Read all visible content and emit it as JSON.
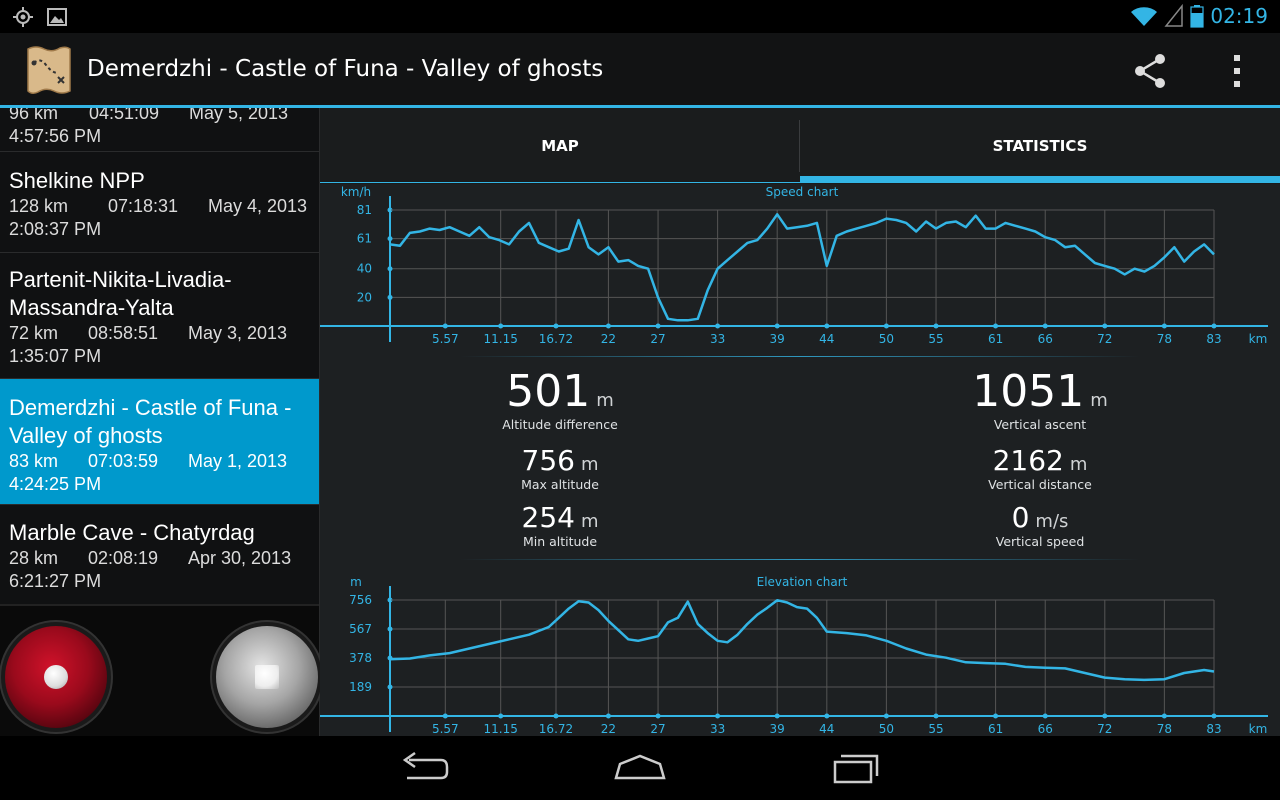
{
  "status_bar": {
    "time": "02:19",
    "icons": [
      "location-icon",
      "image-icon",
      "wifi-icon",
      "signal-icon",
      "battery-icon"
    ]
  },
  "action_bar": {
    "title": "Demerdzhi - Castle of Funa - Valley of ghosts",
    "actions": [
      "share-icon",
      "overflow-menu-icon"
    ]
  },
  "track_list": [
    {
      "name": "",
      "distance": "96 km",
      "duration": "04:51:09",
      "date": "May 5, 2013",
      "start_time": "4:57:56 PM",
      "selected": false
    },
    {
      "name": "Shelkine NPP",
      "distance": "128 km",
      "duration": "07:18:31",
      "date": "May 4, 2013",
      "start_time": "2:08:37 PM",
      "selected": false
    },
    {
      "name": "Partenit-Nikita-Livadia-Massandra-Yalta",
      "name_line1": "Partenit-Nikita-Livadia-",
      "name_line2": "Massandra-Yalta",
      "distance": "72 km",
      "duration": "08:58:51",
      "date": "May 3, 2013",
      "start_time": "1:35:07 PM",
      "selected": false
    },
    {
      "name": "Demerdzhi - Castle of Funa - Valley of ghosts",
      "name_line1": "Demerdzhi - Castle of Funa -",
      "name_line2": "Valley of ghosts",
      "distance": "83 km",
      "duration": "07:03:59",
      "date": "May 1, 2013",
      "start_time": "4:24:25 PM",
      "selected": true
    },
    {
      "name": "Marble Cave - Chatyrdag",
      "distance": "28 km",
      "duration": "02:08:19",
      "date": "Apr 30, 2013",
      "start_time": "6:21:27 PM",
      "selected": false
    }
  ],
  "tabs": [
    {
      "label": "MAP",
      "active": false
    },
    {
      "label": "STATISTICS",
      "active": true
    }
  ],
  "stats": {
    "altitude_difference": {
      "value": "501",
      "unit": "m",
      "label": "Altitude difference"
    },
    "vertical_ascent": {
      "value": "1051",
      "unit": "m",
      "label": "Vertical ascent"
    },
    "max_altitude": {
      "value": "756",
      "unit": "m",
      "label": "Max altitude"
    },
    "vertical_distance": {
      "value": "2162",
      "unit": "m",
      "label": "Vertical distance"
    },
    "min_altitude": {
      "value": "254",
      "unit": "m",
      "label": "Min altitude"
    },
    "vertical_speed": {
      "value": "0",
      "unit": "m/s",
      "label": "Vertical speed"
    }
  },
  "colors": {
    "accent": "#33b5e5",
    "selected_row": "#0099cc",
    "record": "#b0101f"
  },
  "chart_data": [
    {
      "type": "line",
      "title": "Speed chart",
      "ylabel": "km/h",
      "xlabel": "km",
      "x_ticks": [
        "5.57",
        "11.15",
        "16.72",
        "22",
        "27",
        "33",
        "39",
        "44",
        "50",
        "55",
        "61",
        "66",
        "72",
        "78",
        "83"
      ],
      "y_ticks": [
        "20",
        "40",
        "61",
        "81"
      ],
      "xlim": [
        0,
        83
      ],
      "ylim": [
        0,
        81
      ],
      "grid": true,
      "series": [
        {
          "x": [
            0,
            1,
            2,
            3,
            4,
            5,
            6,
            7,
            8,
            9,
            10,
            11,
            12,
            13,
            14,
            15,
            16,
            17,
            18,
            19,
            20,
            21,
            22,
            23,
            24,
            25,
            26,
            27,
            28,
            29,
            30,
            31,
            32,
            33,
            34,
            35,
            36,
            37,
            38,
            39,
            40,
            41,
            42,
            43,
            44,
            45,
            46,
            47,
            48,
            49,
            50,
            51,
            52,
            53,
            54,
            55,
            56,
            57,
            58,
            59,
            60,
            61,
            62,
            63,
            64,
            65,
            66,
            67,
            68,
            69,
            70,
            71,
            72,
            73,
            74,
            75,
            76,
            77,
            78,
            79,
            80,
            81,
            82,
            83
          ],
          "y": [
            57,
            56,
            65,
            66,
            68,
            67,
            69,
            66,
            63,
            69,
            62,
            60,
            57,
            66,
            72,
            58,
            55,
            52,
            54,
            74,
            55,
            50,
            55,
            45,
            46,
            42,
            40,
            20,
            5,
            4,
            4,
            5,
            25,
            40,
            46,
            52,
            58,
            60,
            68,
            78,
            68,
            69,
            70,
            72,
            42,
            63,
            66,
            68,
            70,
            72,
            75,
            74,
            72,
            66,
            73,
            68,
            72,
            73,
            69,
            77,
            68,
            68,
            72,
            70,
            68,
            66,
            62,
            60,
            55,
            56,
            50,
            44,
            42,
            40,
            36,
            40,
            38,
            42,
            48,
            55,
            45,
            52,
            57,
            50
          ]
        }
      ]
    },
    {
      "type": "line",
      "title": "Elevation chart",
      "ylabel": "m",
      "xlabel": "km",
      "x_ticks": [
        "5.57",
        "11.15",
        "16.72",
        "22",
        "27",
        "33",
        "39",
        "44",
        "50",
        "55",
        "61",
        "66",
        "72",
        "78",
        "83"
      ],
      "y_ticks": [
        "189",
        "378",
        "567",
        "756"
      ],
      "xlim": [
        0,
        83
      ],
      "ylim": [
        0,
        756
      ],
      "grid": true,
      "series": [
        {
          "x": [
            0,
            2,
            4,
            6,
            8,
            10,
            12,
            14,
            16,
            17,
            18,
            19,
            20,
            21,
            22,
            23,
            24,
            25,
            26,
            27,
            28,
            29,
            30,
            31,
            32,
            33,
            34,
            35,
            36,
            37,
            38,
            39,
            40,
            41,
            42,
            43,
            44,
            46,
            48,
            50,
            52,
            54,
            56,
            58,
            60,
            62,
            64,
            66,
            68,
            70,
            72,
            74,
            76,
            78,
            80,
            82,
            83
          ],
          "y": [
            370,
            375,
            395,
            410,
            440,
            470,
            500,
            530,
            580,
            640,
            700,
            748,
            740,
            690,
            620,
            560,
            500,
            490,
            505,
            520,
            610,
            640,
            745,
            600,
            540,
            490,
            480,
            530,
            600,
            660,
            705,
            755,
            740,
            710,
            700,
            640,
            550,
            540,
            525,
            490,
            440,
            400,
            380,
            350,
            345,
            340,
            320,
            315,
            310,
            280,
            250,
            240,
            235,
            240,
            280,
            300,
            290
          ]
        }
      ]
    }
  ]
}
